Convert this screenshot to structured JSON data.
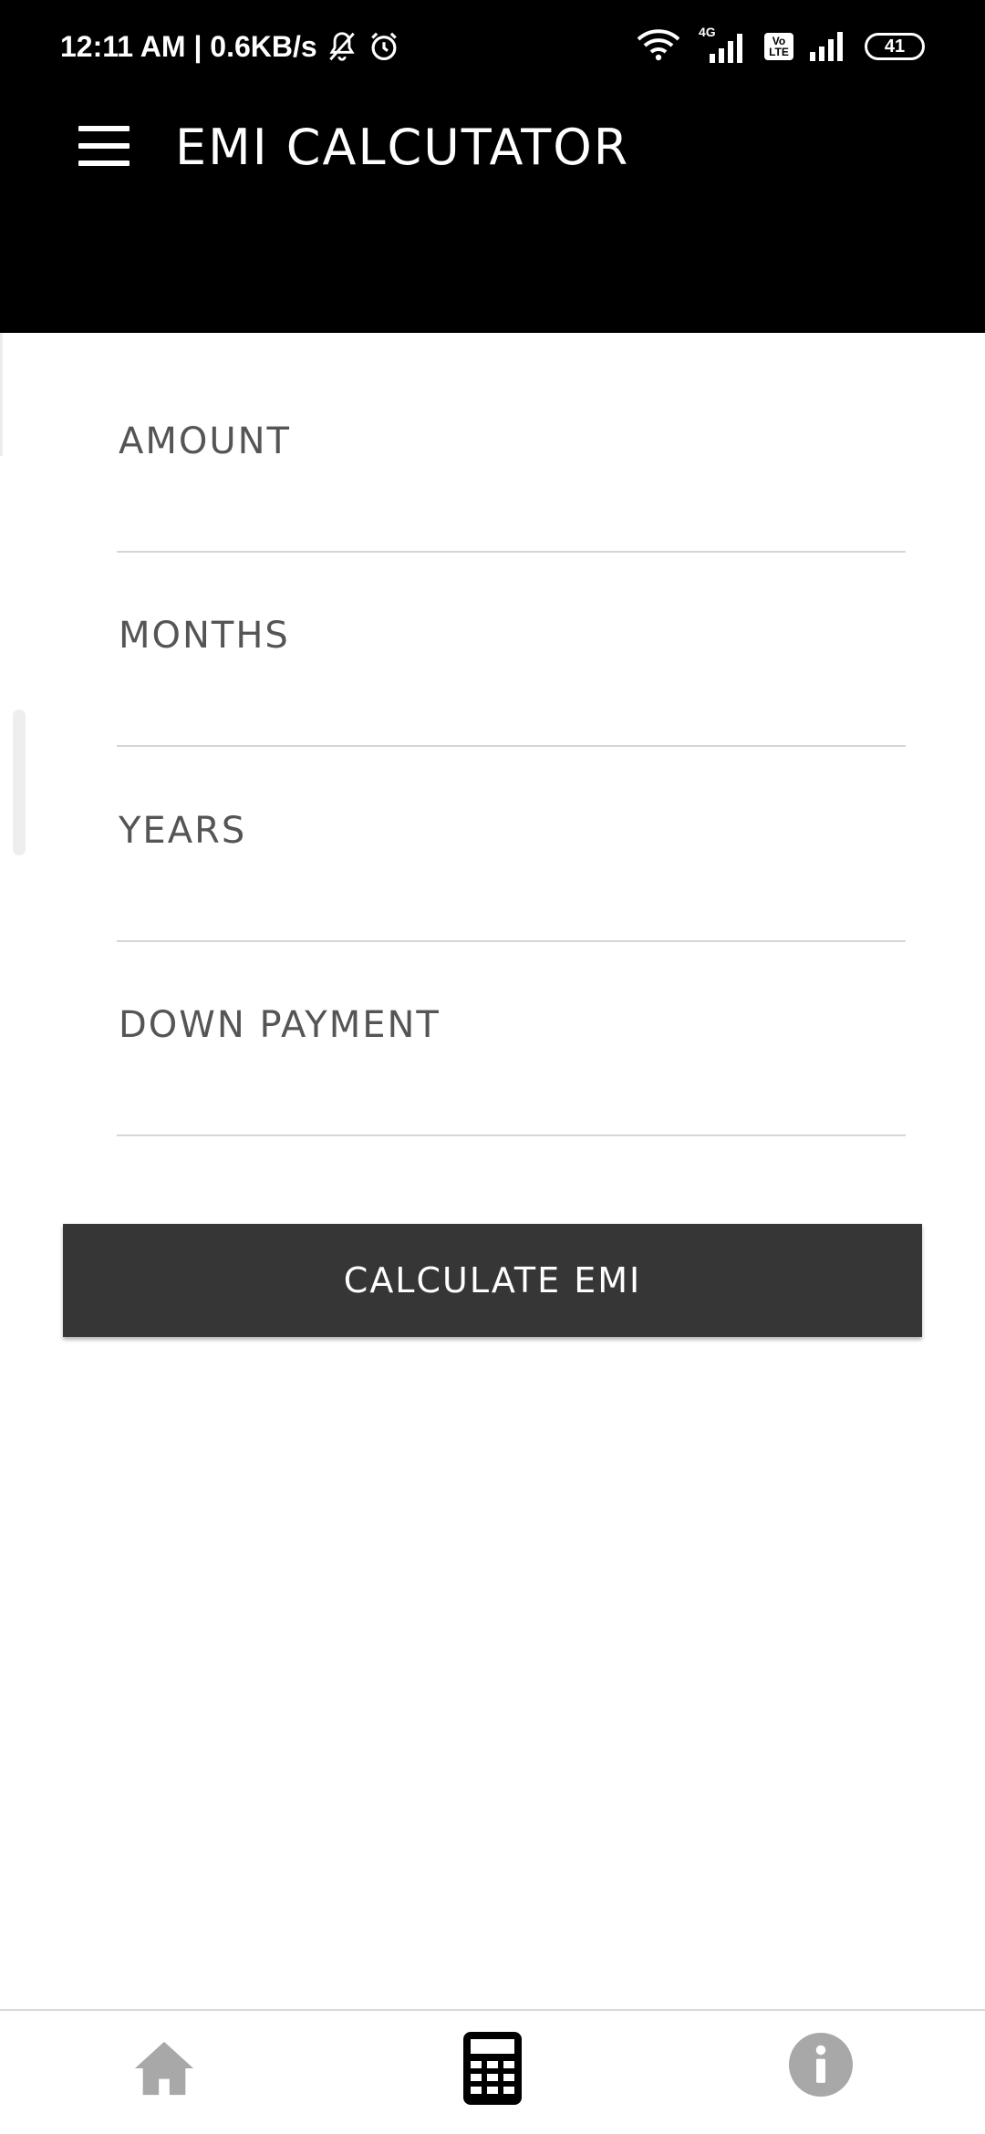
{
  "status_bar": {
    "time_speed": "12:11 AM | 0.6KB/s",
    "network_type": "4G",
    "volte_top": "Vo",
    "volte_bottom": "LTE",
    "battery": "41",
    "icons": [
      "bell-muted-icon",
      "alarm-icon",
      "wifi-icon",
      "signal-4g-icon",
      "volte-icon",
      "signal-icon",
      "battery-icon"
    ]
  },
  "app_bar": {
    "title": "EMI CALCUTATOR",
    "menu_icon": "hamburger-menu-icon"
  },
  "form": {
    "fields": [
      {
        "label": "AMOUNT",
        "value": ""
      },
      {
        "label": "MONTHS",
        "value": ""
      },
      {
        "label": "YEARS",
        "value": ""
      },
      {
        "label": "DOWN PAYMENT",
        "value": ""
      }
    ],
    "submit_label": "CALCULATE EMI"
  },
  "bottom_nav": {
    "items": [
      {
        "icon": "home-icon",
        "active": false
      },
      {
        "icon": "calculator-icon",
        "active": true
      },
      {
        "icon": "info-icon",
        "active": false
      }
    ]
  },
  "colors": {
    "app_bar": "#000000",
    "button": "#363636",
    "label": "#555555",
    "inactive_nav": "#a8a8a8",
    "active_nav": "#000000"
  }
}
